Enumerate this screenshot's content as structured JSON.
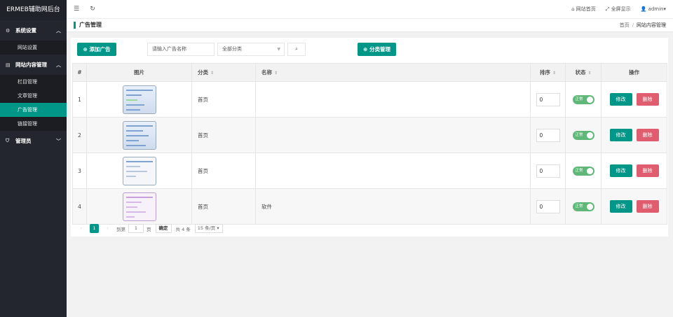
{
  "app_title": "ERMEB辅助网后台",
  "sidebar": {
    "groups": [
      {
        "label": "系统设置",
        "icon": "gear-icon",
        "chevron": "^",
        "items": [
          {
            "label": "网站设置",
            "active": false
          }
        ]
      },
      {
        "label": "网站内容管理",
        "icon": "document-icon",
        "chevron": "^",
        "items": [
          {
            "label": "栏目管理",
            "active": false
          },
          {
            "label": "文章管理",
            "active": false
          },
          {
            "label": "广告管理",
            "active": true
          },
          {
            "label": "链接管理",
            "active": false
          }
        ]
      },
      {
        "label": "管理员",
        "icon": "shield-icon",
        "chevron": "v",
        "items": []
      }
    ]
  },
  "topbar": {
    "menu_toggle_icon": "☰",
    "refresh_icon": "↻",
    "site_home": "网站首页",
    "fullscreen": "全屏显示",
    "user": "admin"
  },
  "breadcrumb": {
    "title": "广告管理",
    "items": [
      "首页",
      "网站内容管理"
    ],
    "separator": "/"
  },
  "toolbar": {
    "add_label": "添加广告",
    "name_placeholder": "请输入广告名称",
    "category_value": "全部分类",
    "search_icon": "⌕",
    "category_manage_label": "分类管理"
  },
  "table": {
    "headers": {
      "index": "#",
      "image": "图片",
      "category": "分类",
      "name": "名称",
      "sort": "排序",
      "status": "状态",
      "ops": "操作"
    },
    "rows": [
      {
        "index": "1",
        "category": "首页",
        "name": "",
        "sort": "0",
        "status": "正常"
      },
      {
        "index": "2",
        "category": "首页",
        "name": "",
        "sort": "0",
        "status": "正常"
      },
      {
        "index": "3",
        "category": "首页",
        "name": "",
        "sort": "0",
        "status": "正常"
      },
      {
        "index": "4",
        "category": "首页",
        "name": "软件",
        "sort": "0",
        "status": "正常"
      }
    ],
    "edit_label": "修改",
    "delete_label": "删除"
  },
  "pagination": {
    "prev": "‹",
    "current": "1",
    "next": "›",
    "goto_label": "到第",
    "goto_value": "1",
    "page_unit": "页",
    "confirm": "确定",
    "total": "共 4 条",
    "page_size": "15 条/页"
  },
  "colors": {
    "accent": "#009688",
    "danger": "#e05d6f",
    "switch_on": "#5fb878",
    "sidebar_bg": "#23262e"
  }
}
